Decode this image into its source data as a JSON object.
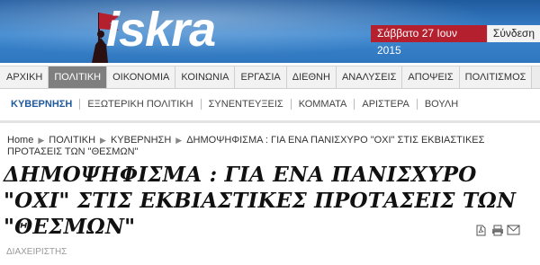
{
  "brand": {
    "logo_text": "iskra"
  },
  "header": {
    "date_label": "Σάββατο",
    "date_value": "27 Ιουν 2015",
    "login_label": "Σύνδεση"
  },
  "topnav": {
    "items": [
      {
        "label": "ΑΡΧΙΚΗ"
      },
      {
        "label": "ΠΟΛΙΤΙΚΗ"
      },
      {
        "label": "ΟΙΚΟΝΟΜΙΑ"
      },
      {
        "label": "ΚΟΙΝΩΝΙΑ"
      },
      {
        "label": "ΕΡΓΑΣΙΑ"
      },
      {
        "label": "ΔΙΕΘΝΗ"
      },
      {
        "label": "ΑΝΑΛΥΣΕΙΣ"
      },
      {
        "label": "ΑΠΟΨΕΙΣ"
      },
      {
        "label": "ΠΟΛΙΤΙΣΜΟΣ"
      }
    ],
    "active_index": 1
  },
  "subnav": {
    "items": [
      {
        "label": "ΚΥΒΕΡΝΗΣΗ"
      },
      {
        "label": "ΕΞΩΤΕΡΙΚΗ ΠΟΛΙΤΙΚΗ"
      },
      {
        "label": "ΣΥΝΕΝΤΕΥΞΕΙΣ"
      },
      {
        "label": "ΚΟΜΜΑΤΑ"
      },
      {
        "label": "ΑΡΙΣΤΕΡΑ"
      },
      {
        "label": "ΒΟΥΛΗ"
      }
    ]
  },
  "breadcrumb": {
    "home": "Home",
    "section": "ΠΟΛΙΤΙΚΗ",
    "subsection": "ΚΥΒΕΡΝΗΣΗ",
    "current": "ΔΗΜΟΨΗΦΙΣΜΑ : ΓΙΑ ΕΝΑ ΠΑΝΙΣΧΥΡΟ \"ΟΧΙ\" ΣΤΙΣ ΕΚΒΙΑΣΤΙΚΕΣ ΠΡΟΤΑΣΕΙΣ ΤΩΝ \"ΘΕΣΜΩΝ\""
  },
  "article": {
    "title": "ΔΗΜΟΨΗΦΙΣΜΑ : ΓΙΑ ΕΝΑ ΠΑΝΙΣΧΥΡΟ \"ΟΧΙ\" ΣΤΙΣ ΕΚΒΙΑΣΤΙΚΕΣ ΠΡΟΤΑΣΕΙΣ ΤΩΝ \"ΘΕΣΜΩΝ\"",
    "author": "ΔΙΑΧΕΙΡΙΣΤΗΣ"
  },
  "tools": [
    {
      "icon": "pdf-icon"
    },
    {
      "icon": "print-icon"
    },
    {
      "icon": "email-icon"
    }
  ],
  "colors": {
    "header_blue": "#2b6fb3",
    "date_red": "#b5202e",
    "active_tab": "#7f7f7f",
    "subnav_active": "#1f5a9e"
  }
}
